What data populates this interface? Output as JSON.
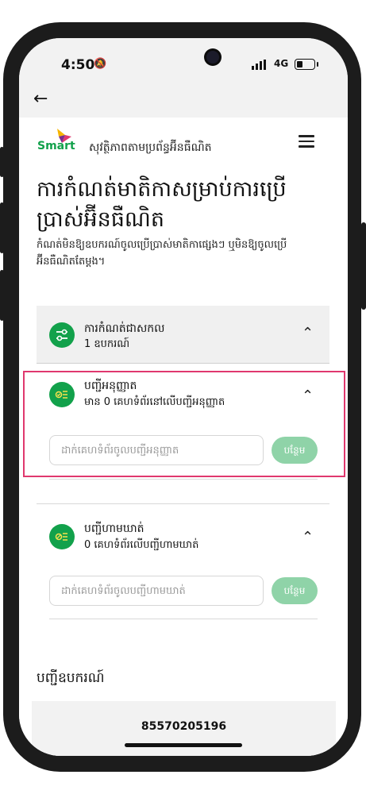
{
  "status_bar": {
    "time": "4:50",
    "network": "4G",
    "battery_level": 0.35
  },
  "nav": {
    "back_icon": "arrow-left-icon"
  },
  "header": {
    "brand": "Smart",
    "site_title": "សុវត្ថិភាពតាមប្រព័ន្ធអ៊ីនធឺណិត",
    "menu_icon": "hamburger-menu-icon"
  },
  "page": {
    "title": "ការកំណត់មាតិកាសម្រាប់ការប្រើប្រាស់អ៊ីនធឺណិត",
    "description": "កំណត់មិនឱ្យឧបករណ៍ចូលប្រើប្រាស់មាតិកាផ្សេងៗ ឬមិនឱ្យចូលប្រើអ៊ីនធឺណិតតែម្តង។"
  },
  "sections": {
    "general": {
      "title": "ការកំណត់ជាសកល",
      "subtitle": "1 ឧបករណ៍",
      "icon": "sliders-icon"
    },
    "allowlist": {
      "title": "បញ្ជីអនុញ្ញាត",
      "subtitle": "មាន 0 គេហទំព័រនៅលើបញ្ជីអនុញ្ញាត",
      "input_placeholder": "ដាក់គេហទំព័រចូលបញ្ជីអនុញ្ញាត",
      "add_label": "បន្ថែម",
      "icon": "checklist-icon"
    },
    "blocklist": {
      "title": "បញ្ជីហាមឃាត់",
      "subtitle": "0 គេហទំព័រលើបញ្ជីហាមឃាត់",
      "input_placeholder": "ដាក់គេហទំព័រចូលបញ្ជីហាមឃាត់",
      "add_label": "បន្ថែម",
      "icon": "block-list-icon"
    }
  },
  "devices": {
    "heading": "បញ្ជីឧបករណ៍",
    "items": [
      "85570205196"
    ]
  },
  "colors": {
    "brand_green": "#12a14b",
    "button_green_disabled": "#8fd3a8",
    "highlight": "#e0386e"
  }
}
